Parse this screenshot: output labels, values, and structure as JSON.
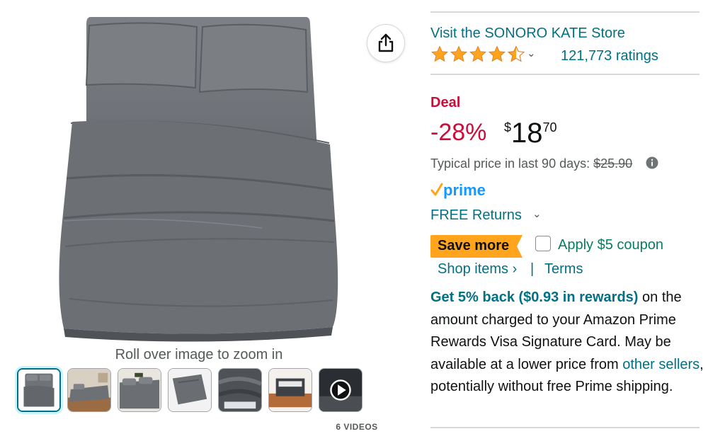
{
  "gallery": {
    "zoom_hint": "Roll over image to zoom in",
    "videos_label": "6 VIDEOS",
    "thumbnails": [
      {
        "label": "bed-sheet-top-view",
        "active": true
      },
      {
        "label": "bedroom-scene"
      },
      {
        "label": "bed-with-pillows"
      },
      {
        "label": "pillowcase-closeup"
      },
      {
        "label": "fabric-closeup"
      },
      {
        "label": "packaged-sheets"
      },
      {
        "label": "video-thumbnail"
      }
    ],
    "colors": {
      "sheet": "#6f7378",
      "sheet_shadow": "#55595e",
      "selected_border": "#007185"
    }
  },
  "product": {
    "store_link": "Visit the SONORO KATE Store",
    "rating_stars": 4.5,
    "ratings_count": "121,773 ratings",
    "deal_label": "Deal",
    "discount": "-28%",
    "price": {
      "symbol": "$",
      "whole": "18",
      "fraction": "70"
    },
    "typical_price_label": "Typical price in last 90 days:",
    "typical_price": "$25.90",
    "prime": "prime",
    "free_returns": "FREE Returns",
    "save_more_badge": "Save more",
    "coupon_label": "Apply $5 coupon",
    "coupon_checked": false,
    "shop_items": "Shop items ›",
    "separator": "|",
    "terms": "Terms",
    "rewards": {
      "highlight": "Get 5% back ($0.93 in rewards)",
      "text_1": " on the amount charged to your Amazon Prime Rewards Visa Signature Card. May be available at a lower price from ",
      "other_sellers": "other sellers",
      "text_2": ", potentially without free Prime shipping."
    }
  },
  "colors": {
    "link": "#007185",
    "deal_red": "#cc0c39",
    "star": "#ffa41c",
    "prime_blue": "#1399ff",
    "badge_orange": "#ffa41c",
    "coupon_green": "#067d62"
  }
}
